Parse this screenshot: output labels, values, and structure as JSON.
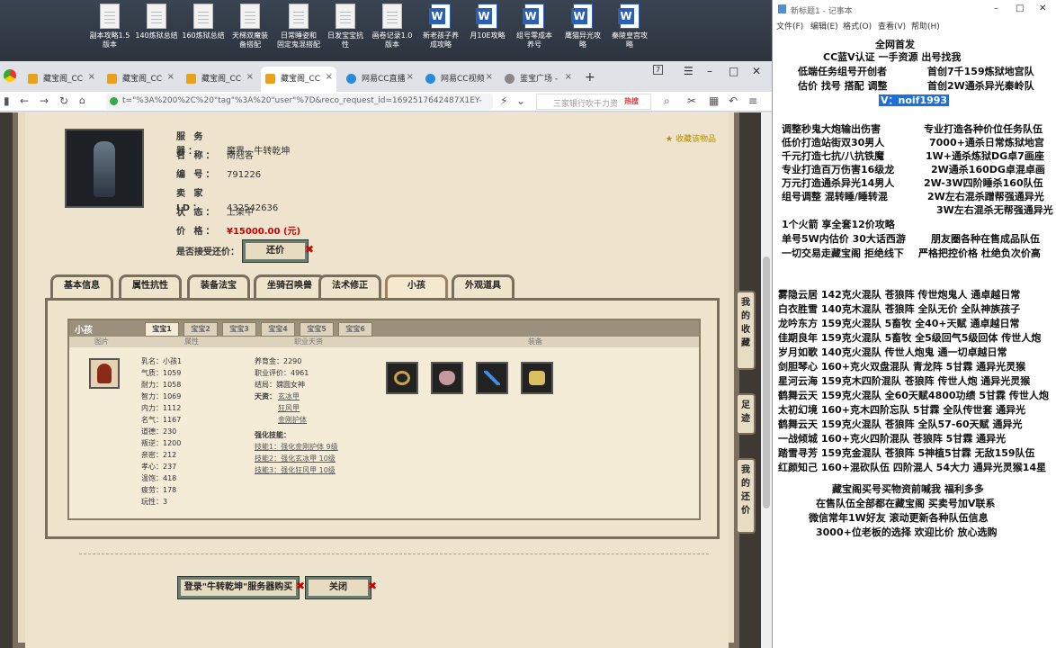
{
  "desktop_icons": [
    {
      "label": "副本攻略1.5\n版本",
      "icon": "doc-icon"
    },
    {
      "label": "140炼狱总结",
      "icon": "doc-icon"
    },
    {
      "label": "160炼狱总结",
      "icon": "doc-icon"
    },
    {
      "label": "天梯双魔装\n备搭配",
      "icon": "doc-icon"
    },
    {
      "label": "日常睡姿和\n固定鬼混搭配",
      "icon": "doc-icon"
    },
    {
      "label": "日发宝宝抗\n性",
      "icon": "doc-icon"
    },
    {
      "label": "画卷记录1.0\n版本",
      "icon": "doc-icon"
    },
    {
      "label": "新老孩子养\n成攻略",
      "icon": "word-icon"
    },
    {
      "label": "月10E攻略",
      "icon": "word-icon"
    },
    {
      "label": "组号零成本\n养号",
      "icon": "word-icon"
    },
    {
      "label": "鹰猫异光攻\n略",
      "icon": "word-icon"
    },
    {
      "label": "秦陵皇宫攻\n略",
      "icon": "word-icon"
    }
  ],
  "browser": {
    "tabs": [
      {
        "label": "藏宝阁_CC"
      },
      {
        "label": "藏宝阁_CC"
      },
      {
        "label": "藏宝阁_CC"
      },
      {
        "label": "藏宝阁_CC"
      },
      {
        "label": "网易CC直播"
      },
      {
        "label": "网易CC视频"
      },
      {
        "label": "鉴宝广场 -"
      }
    ],
    "tab_counter": "7",
    "url": "t=\"%3A%200%2C%20\"tag\"%3A%20\"user\"%7D&reco_request_id=1692517642487X1EY-",
    "search_placeholder": "三家银行吹干力资",
    "hot_label": "热搜"
  },
  "item": {
    "server_label": "服 务 器：",
    "server": "魔界-- 牛转乾坤",
    "name_label": "名 称：",
    "name": "南冠客",
    "id_label": "编 号：",
    "id": "791226",
    "seller_label": "卖 家 ID：",
    "seller": "432542636",
    "status_label": "状 态：",
    "status": "上架中",
    "price_label": "价 格：",
    "price": "¥15000.00 (元)",
    "bargain_label": "是否接受还价：",
    "bargain_button": "还价",
    "collect": "收藏该物品"
  },
  "main_tabs": [
    "基本信息",
    "属性抗性",
    "装备法宝",
    "坐骑召唤兽",
    "法术修正",
    "小孩",
    "外观道具"
  ],
  "pet": {
    "title": "小孩",
    "subtabs": [
      "宝宝1",
      "宝宝2",
      "宝宝3",
      "宝宝4",
      "宝宝5",
      "宝宝6"
    ],
    "columns": [
      "图片",
      "属性",
      "职业天资",
      "装备"
    ],
    "stats": [
      "乳名：小孩1",
      "气质：1059",
      "耐力：1058",
      "智力：1069",
      "内力：1112",
      "名气：1167",
      "道德：230",
      "叛逆：1200",
      "亲密：212",
      "孝心：237",
      "温饱：418",
      "疲劳：178",
      "玩性：3"
    ],
    "career": {
      "money": "养育金：2290",
      "rating": "职业评价：4961",
      "ending": "结局：嫦圆女神",
      "talent_label": "天资：",
      "talents": [
        "玄冰甲",
        "狂风甲",
        "金刚护体"
      ],
      "skill_label": "强化技能：",
      "skills": [
        "技能1：强化金刚护体 9级",
        "技能2：强化玄冰甲 10级",
        "技能3：强化狂风甲 10级"
      ]
    }
  },
  "buttons": {
    "login": "登录\"牛转乾坤\"服务器购买",
    "close": "关闭"
  },
  "side_buttons": [
    "我的收藏",
    "足迹",
    "我的还价"
  ],
  "notepad": {
    "title": "新标题1 - 记事本",
    "menu": [
      "文件(F)",
      "编辑(E)",
      "格式(O)",
      "查看(V)",
      "帮助(H)"
    ],
    "lines": [
      "全网首发",
      "CC蓝V认证 一手资源 出号找我",
      "低端任务组号开创者",
      "首创7千159炼狱地宫队",
      "估价 找号 搭配 调整",
      "首创2W通杀异光秦岭队",
      "V：noif1993",
      "调整秒鬼大炮输出伤害",
      "专业打造各种价位任务队伍",
      "低价打造站街双30男人",
      "7000+通杀日常炼狱地宫",
      "千元打造七抗/八抗铁魔",
      "1W+通杀炼狱DG卓7画座",
      "专业打造百万伤害16级龙",
      "2W通杀160DG卓混卓画",
      "万元打造通杀异光14男人",
      "2W-3W四阶睡杀160队伍",
      "组号调整 混转睡/睡转混",
      "2W左右混杀蹭帮强通异光",
      "3W左右混杀无帮强通异光",
      "1个火箭 享全套12价攻略",
      "单号5W内估价 30大话西游",
      "朋友圈各种在售成品队伍",
      "一切交易走藏宝阁 拒绝线下",
      "严格把控价格 杜绝负次价高",
      "雾隐云居 142克火混队 苍狼阵 传世炮鬼人 通卓越日常",
      "白衣胜雪 140克木混队 苍狼阵 全队无价 全队神族孩子",
      "龙吟东方 159克火混队 5畜牧 全40+天赋 通卓越日常",
      "佳期良年 159克火混队 5畜牧 全5级回气5级回体 传世人炮",
      "岁月如歌 140克火混队 传世人炮鬼 通一切卓越日常",
      "剑胆琴心 160+克火双盘混队 青龙阵 5甘霖 通异光灵猴",
      "星河云海 159克木四阶混队 苍狼阵 传世人炮 通异光灵猴",
      "鹤舞云天 159克火混队 全60天赋4800功绩 5甘霖 传世人炮",
      "太初幻境 160+克木四阶忘队 5甘霖 全队传世套 通异光",
      "鹤舞云天 159克火混队 苍狼阵 全队57-60天赋 通异光",
      "一战倾城 160+克火四阶混队 苍狼阵 5甘霖 通异光",
      "踏雪寻芳 159克金混队 苍狼阵 5神植5甘霖 无敌159队伍",
      "红颜知己 160+混砍队伍 四阶混人 54大力 通异光灵猴14星",
      "藏宝阁买号买物资前喊我 福利多多",
      "在售队伍全部都在藏宝阁 买卖号加V联系",
      "微信常年1W好友 滚动更新各种队伍信息",
      "3000+位老板的选择 欢迎比价 放心选购"
    ]
  }
}
